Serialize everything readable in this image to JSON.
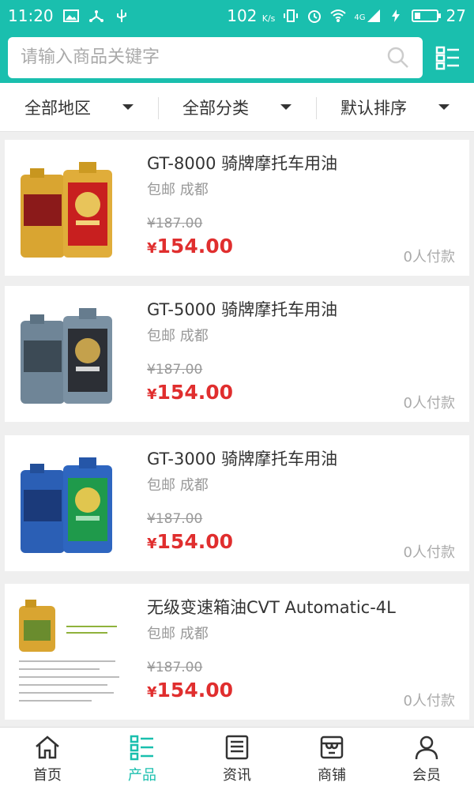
{
  "status_bar": {
    "time": "11:20",
    "network_speed": "102",
    "network_unit": "K/s",
    "signal_label": "4G",
    "battery_percent": "27",
    "battery_level": 0.27
  },
  "search": {
    "placeholder": "请输入商品关键字"
  },
  "filters": [
    {
      "label": "全部地区"
    },
    {
      "label": "全部分类"
    },
    {
      "label": "默认排序"
    }
  ],
  "products": [
    {
      "name": "GT-8000 骑牌摩托车用油",
      "shipping": "包邮 成都",
      "old_price": "¥187.00",
      "currency": "¥",
      "price": "154.00",
      "sold": "0人付款",
      "image": "gold-oil-bottles"
    },
    {
      "name": "GT-5000 骑牌摩托车用油",
      "shipping": "包邮 成都",
      "old_price": "¥187.00",
      "currency": "¥",
      "price": "154.00",
      "sold": "0人付款",
      "image": "gray-oil-bottles"
    },
    {
      "name": "GT-3000 骑牌摩托车用油",
      "shipping": "包邮 成都",
      "old_price": "¥187.00",
      "currency": "¥",
      "price": "154.00",
      "sold": "0人付款",
      "image": "blue-oil-bottles"
    },
    {
      "name": "无级变速箱油CVT Automatic-4L",
      "shipping": "包邮 成都",
      "old_price": "¥187.00",
      "currency": "¥",
      "price": "154.00",
      "sold": "0人付款",
      "image": "cvt-oil-jug"
    }
  ],
  "bottom_nav": [
    {
      "label": "首页",
      "icon": "home-icon",
      "active": false
    },
    {
      "label": "产品",
      "icon": "list-icon",
      "active": true
    },
    {
      "label": "资讯",
      "icon": "news-icon",
      "active": false
    },
    {
      "label": "商铺",
      "icon": "shop-icon",
      "active": false
    },
    {
      "label": "会员",
      "icon": "user-icon",
      "active": false
    }
  ],
  "colors": {
    "accent": "#1abfae",
    "price_red": "#e02e2e"
  }
}
